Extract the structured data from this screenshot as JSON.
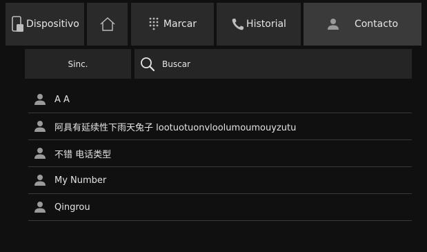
{
  "tabs": {
    "dispositivo": {
      "label": "Dispositivo",
      "icon": "phone-device-icon"
    },
    "home": {
      "icon": "home-icon"
    },
    "marcar": {
      "label": "Marcar",
      "icon": "dialpad-icon"
    },
    "historial": {
      "label": "Historial",
      "icon": "phone-handset-icon"
    },
    "contacto": {
      "label": "Contacto",
      "icon": "person-icon",
      "active": true
    }
  },
  "subbar": {
    "sinc_label": "Sinc.",
    "buscar_label": "Buscar",
    "search_icon": "search-icon"
  },
  "contacts": [
    {
      "name": "A A"
    },
    {
      "name": "阿具有延续性下雨天兔子 lootuotuonvloolumoumouyzutu"
    },
    {
      "name": "不错 电话类型"
    },
    {
      "name": "My Number"
    },
    {
      "name": "Qingrou"
    }
  ],
  "colors": {
    "background": "#101010",
    "tab": "#2a2a2a",
    "tab_active": "#3b3b3b",
    "icon_gray": "#9a9a9a",
    "divider": "#3a3a3a"
  }
}
